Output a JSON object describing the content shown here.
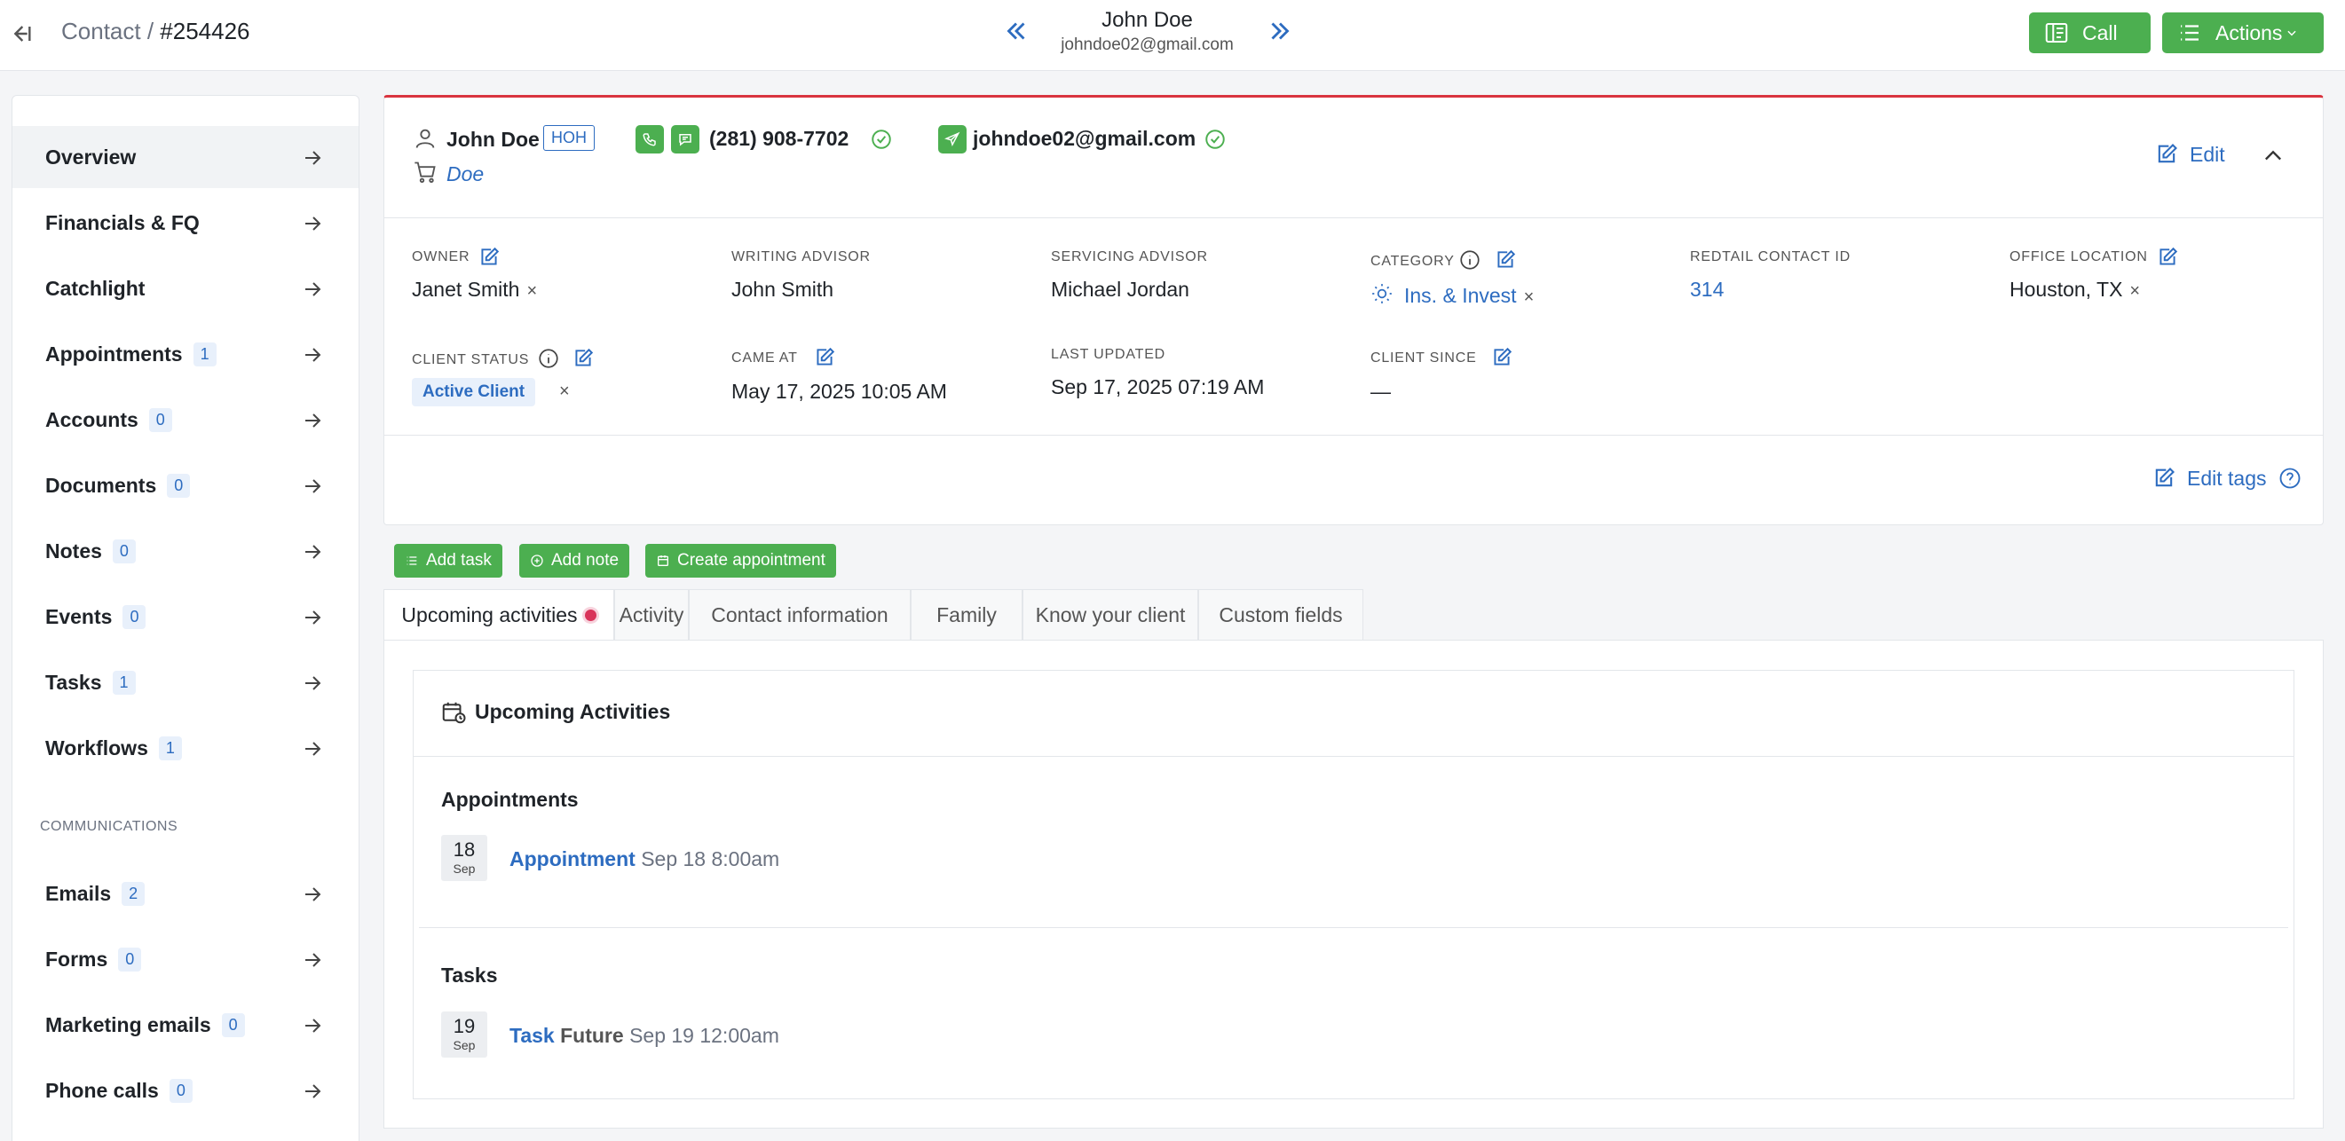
{
  "header": {
    "breadcrumb_prefix": "Contact /",
    "contact_number": "#254426",
    "name": "John Doe",
    "email": "johndoe02@gmail.com",
    "call_label": "Call",
    "actions_label": "Actions"
  },
  "sidebar": {
    "items": [
      {
        "label": "Overview",
        "badge": null
      },
      {
        "label": "Financials & FQ",
        "badge": null
      },
      {
        "label": "Catchlight",
        "badge": null
      },
      {
        "label": "Appointments",
        "badge": "1"
      },
      {
        "label": "Accounts",
        "badge": "0"
      },
      {
        "label": "Documents",
        "badge": "0"
      },
      {
        "label": "Notes",
        "badge": "0"
      },
      {
        "label": "Events",
        "badge": "0"
      },
      {
        "label": "Tasks",
        "badge": "1"
      },
      {
        "label": "Workflows",
        "badge": "1"
      }
    ],
    "communications_label": "COMMUNICATIONS",
    "comm_items": [
      {
        "label": "Emails",
        "badge": "2"
      },
      {
        "label": "Forms",
        "badge": "0"
      },
      {
        "label": "Marketing emails",
        "badge": "0"
      },
      {
        "label": "Phone calls",
        "badge": "0"
      }
    ]
  },
  "contact": {
    "name": "John Doe",
    "hoh_badge": "HOH",
    "household": "Doe",
    "phone": "(281) 908-7702",
    "email": "johndoe02@gmail.com",
    "edit_label": "Edit",
    "edit_tags_label": "Edit tags",
    "fields": {
      "owner_label": "OWNER",
      "owner_value": "Janet Smith",
      "writing_advisor_label": "WRITING ADVISOR",
      "writing_advisor_value": "John Smith",
      "servicing_advisor_label": "SERVICING ADVISOR",
      "servicing_advisor_value": "Michael Jordan",
      "category_label": "CATEGORY",
      "category_value": "Ins. & Invest",
      "redtail_label": "REDTAIL CONTACT ID",
      "redtail_value": "314",
      "office_label": "OFFICE LOCATION",
      "office_value": "Houston, TX",
      "client_status_label": "CLIENT STATUS",
      "client_status_value": "Active Client",
      "came_at_label": "CAME AT",
      "came_at_value": "May 17, 2025 10:05 AM",
      "last_updated_label": "LAST UPDATED",
      "last_updated_value": "Sep 17, 2025 07:19 AM",
      "client_since_label": "CLIENT SINCE",
      "client_since_value": "—"
    }
  },
  "actions": {
    "add_task": "Add task",
    "add_note": "Add note",
    "create_appointment": "Create appointment"
  },
  "tabs": [
    "Upcoming activities",
    "Activity",
    "Contact information",
    "Family",
    "Know your client",
    "Custom fields"
  ],
  "upcoming": {
    "title": "Upcoming Activities",
    "appointments_heading": "Appointments",
    "appointment": {
      "day": "18",
      "month": "Sep",
      "title": "Appointment",
      "when": "Sep 18 8:00am"
    },
    "tasks_heading": "Tasks",
    "task": {
      "day": "19",
      "month": "Sep",
      "title": "Task",
      "title_suffix": "Future",
      "when": "Sep 19 12:00am"
    }
  },
  "colors": {
    "accent_green": "#4caf50",
    "link_blue": "#2d6cc0",
    "red_border": "#d9343f"
  }
}
